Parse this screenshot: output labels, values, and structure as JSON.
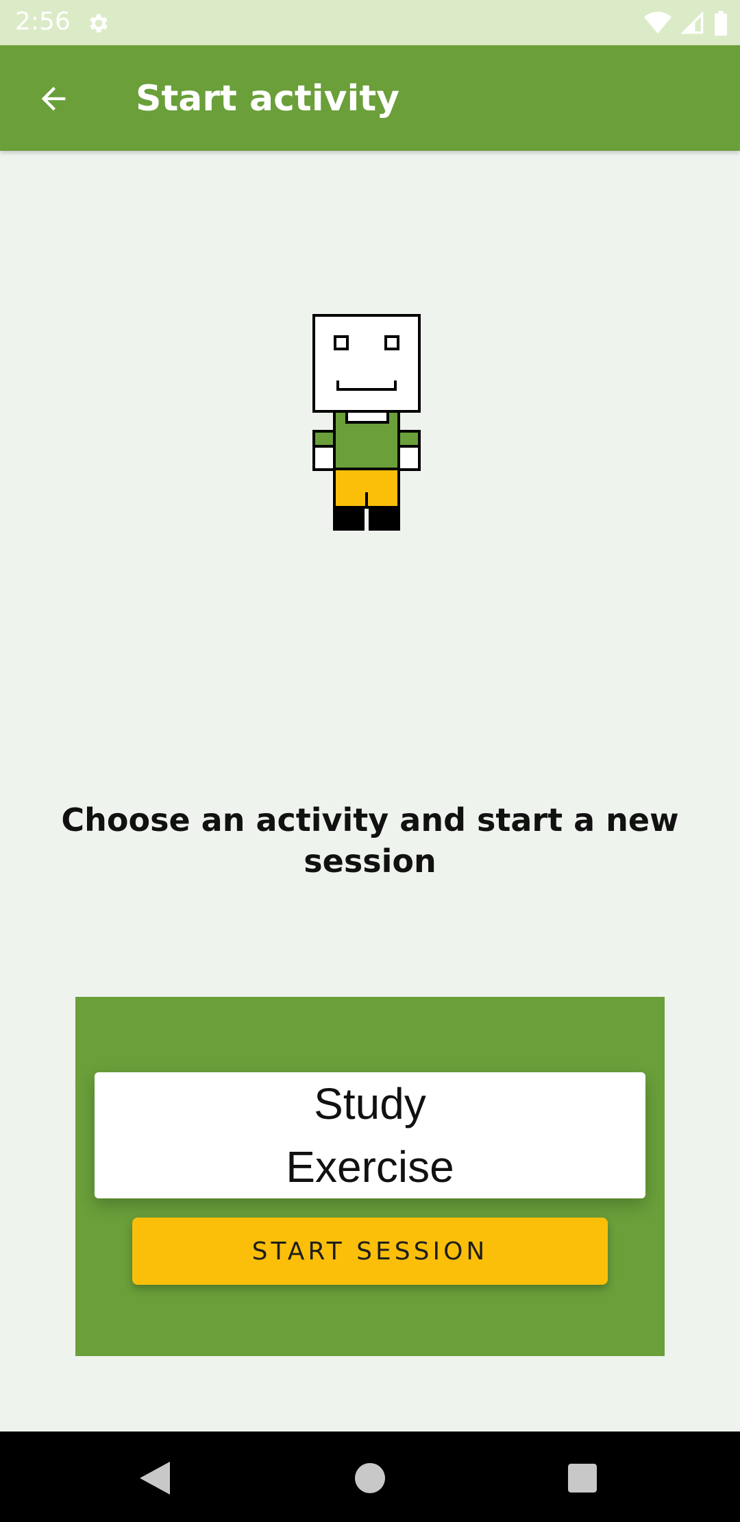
{
  "status_bar": {
    "time": "2:56",
    "left_icon": "gear-icon",
    "right_icons": [
      "wifi-icon",
      "cell-signal-icon",
      "battery-icon"
    ]
  },
  "app_bar": {
    "title": "Start activity",
    "back_icon": "arrow-back-icon"
  },
  "main": {
    "prompt": "Choose an activity and start a new session",
    "activities": [
      "Study",
      "Exercise"
    ],
    "start_button_label": "START SESSION"
  },
  "nav_bar": {
    "icons": [
      "back-triangle-icon",
      "home-circle-icon",
      "recents-square-icon"
    ]
  },
  "colors": {
    "primary": "#6a9f3a",
    "accent": "#fbbf0a",
    "background": "#eff3ee",
    "status_bar": "#dcebc7"
  }
}
